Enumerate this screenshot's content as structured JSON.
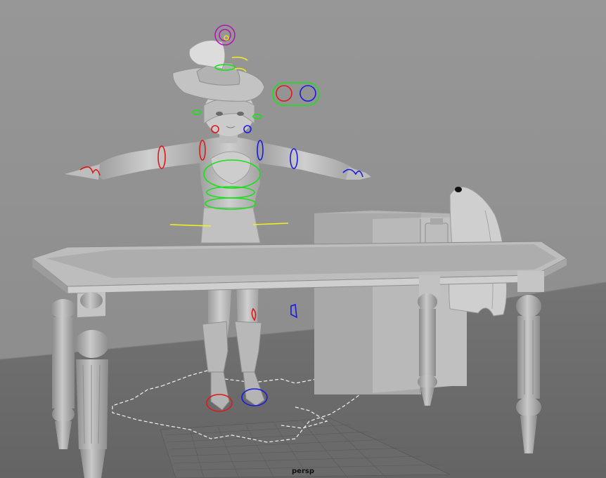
{
  "viewport": {
    "camera_label": "persp"
  },
  "colors": {
    "background_wall": "#8d8d8d",
    "floor": "#6e6e6e",
    "model_light": "#c8c8c8",
    "model_mid": "#a9a9a9",
    "model_dark": "#7a7a7a",
    "ctrl_green": "#19e019",
    "ctrl_red": "#e01818",
    "ctrl_blue": "#1a1ae0",
    "ctrl_yellow": "#f0f020",
    "ctrl_magenta": "#b018b0",
    "ctrl_white": "#ffffff"
  },
  "icons": [
    "rig-controls",
    "switch-control-icon"
  ]
}
